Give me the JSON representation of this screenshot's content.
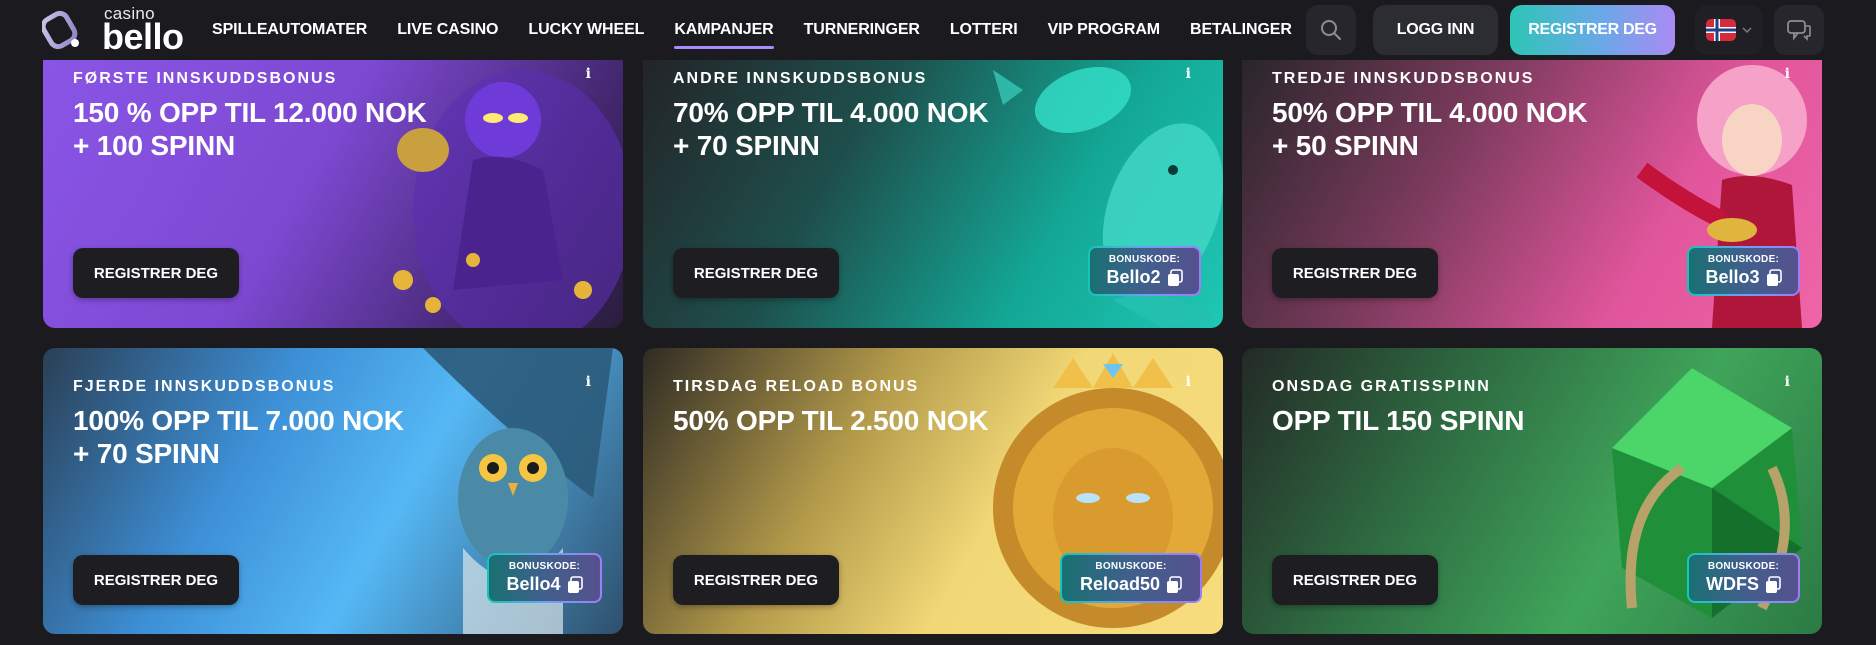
{
  "header": {
    "logo_small": "casino",
    "logo_big": "bello",
    "nav": [
      {
        "label": "SPILLEAUTOMATER",
        "active": false
      },
      {
        "label": "LIVE CASINO",
        "active": false
      },
      {
        "label": "LUCKY WHEEL",
        "active": false
      },
      {
        "label": "KAMPANJER",
        "active": true
      },
      {
        "label": "TURNERINGER",
        "active": false
      },
      {
        "label": "LOTTERI",
        "active": false
      },
      {
        "label": "VIP PROGRAM",
        "active": false
      },
      {
        "label": "BETALINGER",
        "active": false
      }
    ],
    "login_label": "LOGG INN",
    "register_label": "REGISTRER DEG",
    "language_flag": "norway-flag-icon"
  },
  "cards": [
    {
      "subtitle": "FØRSTE INNSKUDDSBONUS",
      "title_line1": "150 % OPP TIL 12.000 NOK",
      "title_line2": "+ 100 SPINN",
      "cta": "REGISTRER DEG",
      "info": "i",
      "art": "genie-character"
    },
    {
      "subtitle": "ANDRE INNSKUDDSBONUS",
      "title_line1": "70% OPP TIL 4.000 NOK",
      "title_line2": "+ 70 SPINN",
      "cta": "REGISTRER DEG",
      "info": "i",
      "bonus_label": "BONUSKODE:",
      "bonus_code": "Bello2",
      "art": "koi-fish"
    },
    {
      "subtitle": "TREDJE INNSKUDDSBONUS",
      "title_line1": "50% OPP TIL 4.000 NOK",
      "title_line2": "+ 50 SPINN",
      "cta": "REGISTRER DEG",
      "info": "i",
      "bonus_label": "BONUSKODE:",
      "bonus_code": "Bello3",
      "art": "pink-haired-heroine"
    },
    {
      "subtitle": "FJERDE INNSKUDDSBONUS",
      "title_line1": "100% OPP TIL 7.000 NOK",
      "title_line2": "+ 70 SPINN",
      "cta": "REGISTRER DEG",
      "info": "i",
      "bonus_label": "BONUSKODE:",
      "bonus_code": "Bello4",
      "art": "owl"
    },
    {
      "subtitle": "TIRSDAG RELOAD BONUS",
      "title_line1": "50% OPP TIL 2.500 NOK",
      "title_line2": "",
      "cta": "REGISTRER DEG",
      "info": "i",
      "bonus_label": "BONUSKODE:",
      "bonus_code": "Reload50",
      "art": "golden-lion"
    },
    {
      "subtitle": "ONSDAG GRATISSPINN",
      "title_line1": "OPP TIL 150 SPINN",
      "title_line2": "",
      "cta": "REGISTRER DEG",
      "info": "i",
      "bonus_label": "BONUSKODE:",
      "bonus_code": "WDFS",
      "art": "emerald-gem"
    }
  ],
  "colors": {
    "background": "#1b1b1f",
    "accent_purple": "#a78bfa",
    "accent_teal": "#2ec5b6"
  }
}
